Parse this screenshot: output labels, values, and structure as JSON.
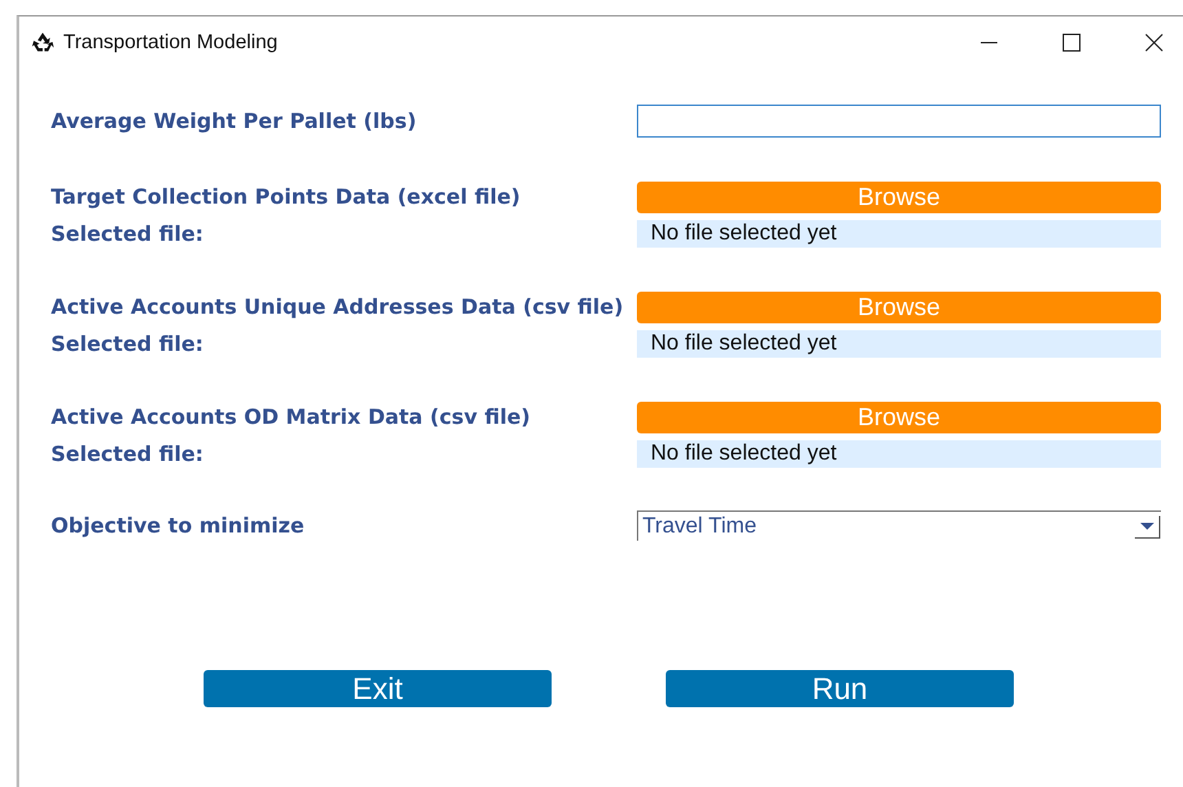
{
  "window": {
    "title": "Transportation Modeling"
  },
  "weight": {
    "label": "Average Weight Per Pallet (lbs)"
  },
  "file_inputs": [
    {
      "label": "Target Collection Points Data (excel file)",
      "button": "Browse",
      "selected_label": "Selected file:",
      "selected_value": "No file selected yet"
    },
    {
      "label": "Active Accounts Unique Addresses Data (csv file)",
      "button": "Browse",
      "selected_label": "Selected file:",
      "selected_value": "No file selected yet"
    },
    {
      "label": "Active Accounts OD Matrix Data (csv file)",
      "button": "Browse",
      "selected_label": "Selected file:",
      "selected_value": "No file selected yet"
    }
  ],
  "objective": {
    "label": "Objective to minimize",
    "value": "Travel Time"
  },
  "buttons": [
    "Exit",
    "Run"
  ]
}
